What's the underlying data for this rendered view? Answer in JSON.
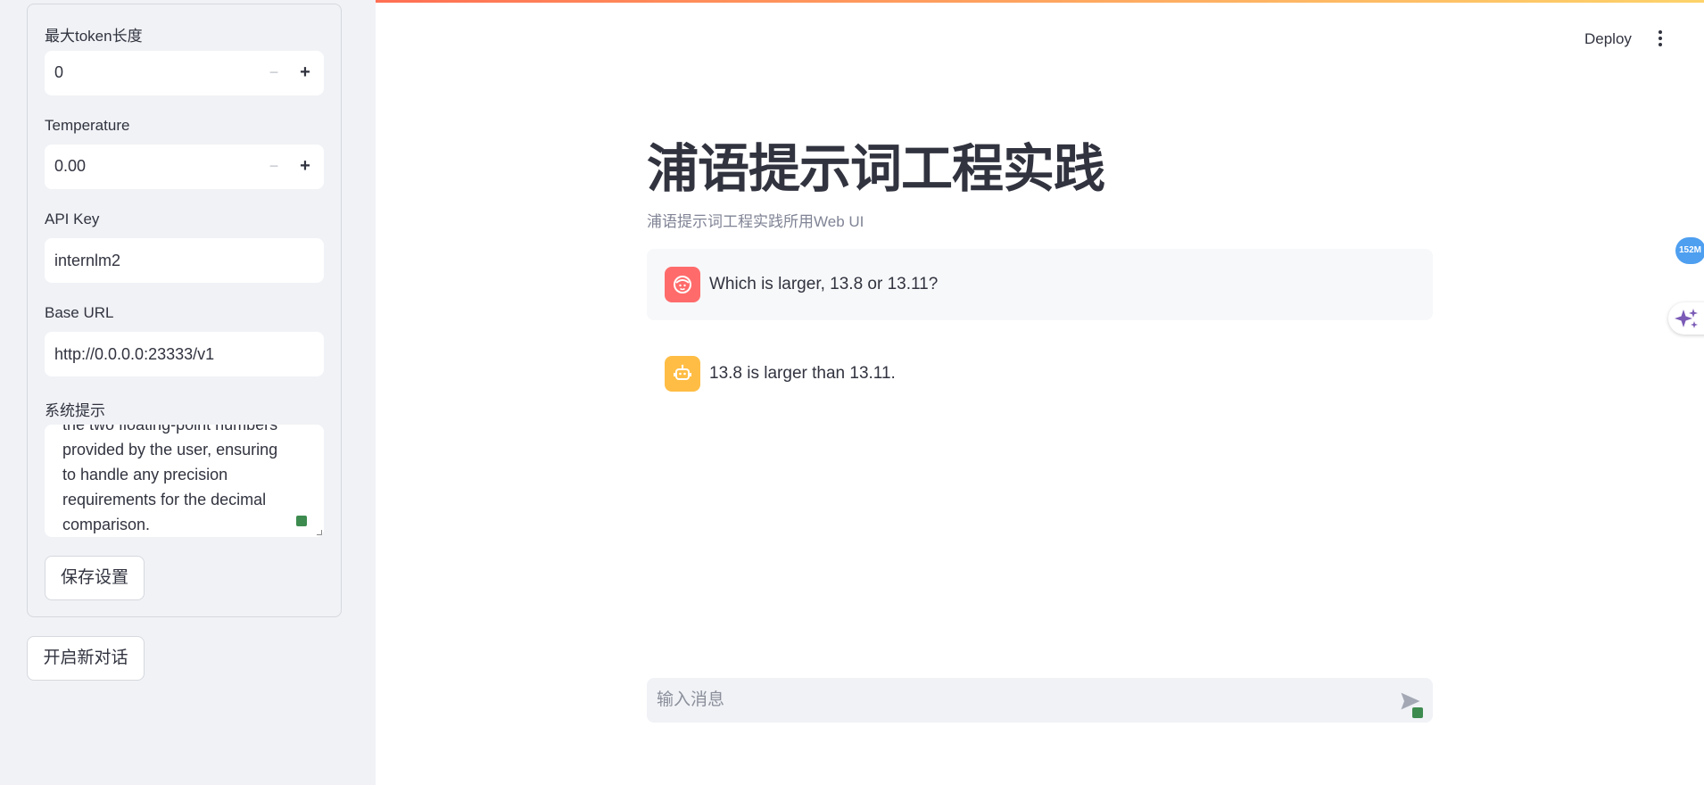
{
  "sidebar": {
    "max_token": {
      "label": "最大token长度",
      "value": "0"
    },
    "temperature": {
      "label": "Temperature",
      "value": "0.00"
    },
    "api_key": {
      "label": "API Key",
      "value": "internlm2"
    },
    "base_url": {
      "label": "Base URL",
      "value": "http://0.0.0.0:23333/v1"
    },
    "system_prompt": {
      "label": "系统提示",
      "lines": [
        "the two floating-point numbers",
        "provided by the user, ensuring",
        "to handle any precision",
        "requirements for the decimal",
        "comparison."
      ]
    },
    "save_button": "保存设置",
    "new_chat_button": "开启新对话"
  },
  "header": {
    "deploy": "Deploy"
  },
  "main": {
    "title": "浦语提示词工程实践",
    "subtitle": "浦语提示词工程实践所用Web UI",
    "messages": [
      {
        "role": "user",
        "text": "Which is larger, 13.8 or 13.11?"
      },
      {
        "role": "assistant",
        "text": "13.8 is larger than 13.11."
      }
    ],
    "chat_input": {
      "placeholder": "输入消息"
    }
  },
  "floating": {
    "memory_badge": "152M"
  },
  "colors": {
    "accent": "#ff4b4b",
    "sidebar_bg": "#f0f2f6",
    "user_avatar": "#ff6b6b",
    "assistant_avatar": "#ffbd45",
    "badge": "#4e9ff0"
  }
}
